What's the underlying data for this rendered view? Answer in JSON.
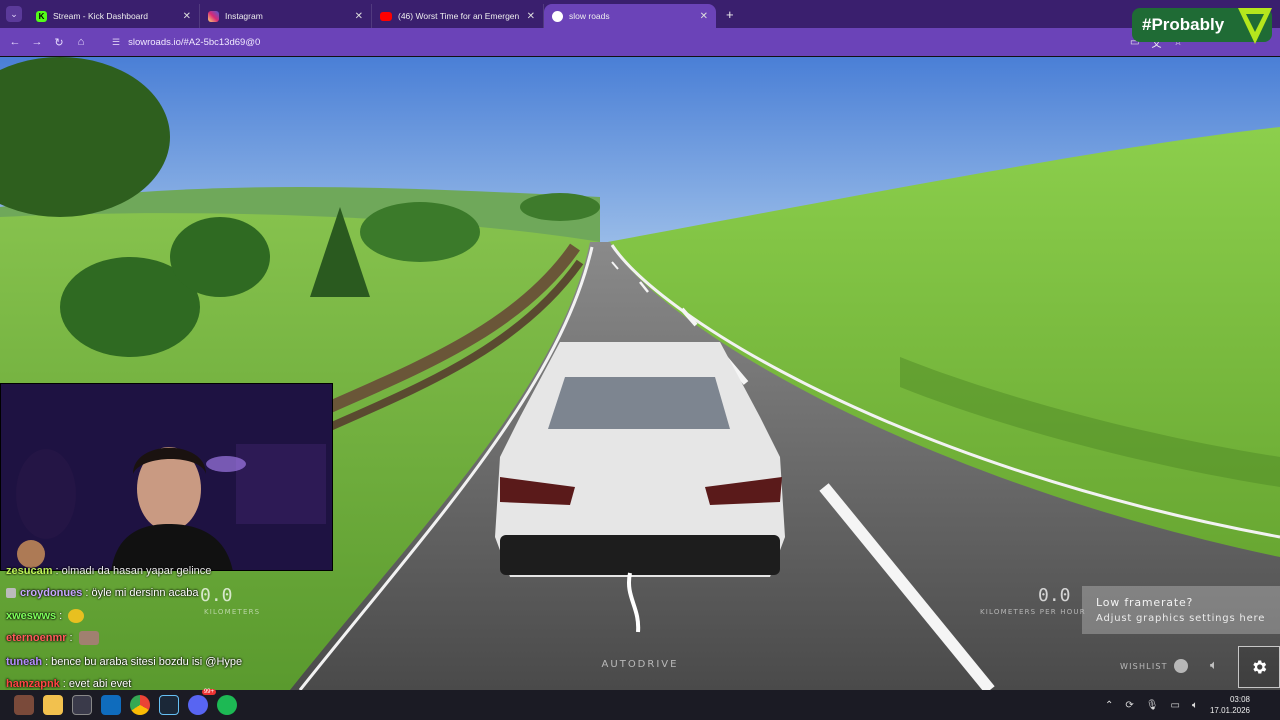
{
  "browser": {
    "tabs": [
      {
        "title": "Stream - Kick Dashboard",
        "favicon_color": "#53fc18",
        "favicon_letter": "K"
      },
      {
        "title": "Instagram",
        "favicon_color": "#d6249f"
      },
      {
        "title": "(46) Worst Time for an Emergen",
        "favicon_color": "#ff0000"
      },
      {
        "title": "slow roads",
        "favicon_color": "#ffffff"
      }
    ],
    "active_tab_index": 3,
    "url": "slowroads.io/#A2-5bc13d69@0",
    "accent_color": "#6b43b8"
  },
  "overlay": {
    "brand_text": "#Probably",
    "brand_color": "#1f6b35",
    "brand_chevron_color": "#b5e61d"
  },
  "chat": {
    "messages": [
      {
        "user": "zesucam",
        "text": ": olmadı da hasan yapar gelince",
        "color": "#c9ff5a"
      },
      {
        "user": "croydonues",
        "text": ": öyle mi dersinn acaba",
        "color": "#c7a6ff"
      },
      {
        "user": "xweswws",
        "text": ":",
        "color": "#7dff5a",
        "emote": true
      },
      {
        "user": "eternoenmr",
        "text": ":",
        "color": "#ff5a5a",
        "emote": true
      },
      {
        "user": "tuneah",
        "text": ": bence bu araba sitesi bozdu isi @Hype",
        "color": "#b58cff"
      },
      {
        "user": "hamzapnk",
        "text": ": evet abi evet",
        "color": "#ff4444"
      }
    ]
  },
  "game": {
    "speed_left": "0.0",
    "speed_left_label": "KILOMETERS",
    "speed_right": "0.0",
    "speed_right_label": "KILOMETERS PER HOUR",
    "autodrive_label": "AUTODRIVE",
    "toast_title": "Low framerate?",
    "toast_body": "Adjust graphics settings here",
    "wishlist_label": "WISHLIST"
  },
  "taskbar": {
    "time": "03:08",
    "date": "17.01.2026",
    "discord_badge": "99+"
  }
}
